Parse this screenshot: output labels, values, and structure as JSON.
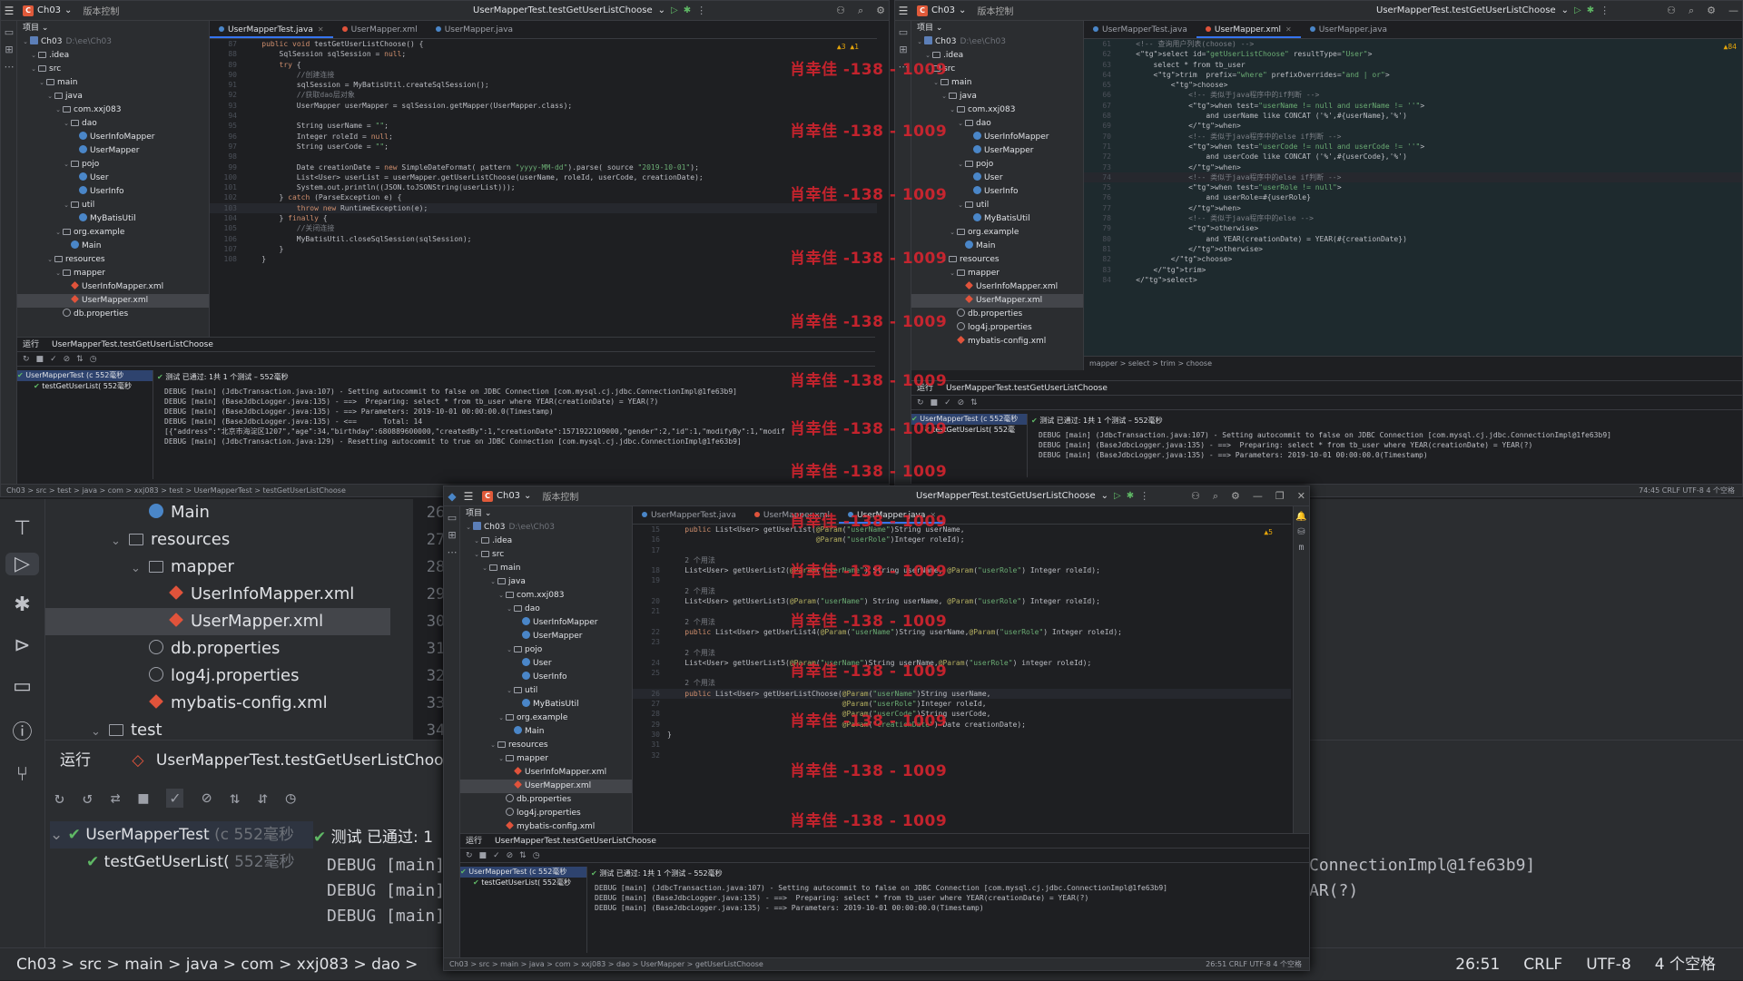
{
  "win1": {
    "project": "Ch03",
    "vcs": "版本控制",
    "run_config": "UserMapperTest.testGetUserListChoose",
    "tabs": [
      {
        "label": "UserMapperTest.java",
        "active": true
      },
      {
        "label": "UserMapper.xml",
        "active": false
      },
      {
        "label": "UserMapper.java",
        "active": false
      }
    ],
    "tree_header": "项目",
    "tree": [
      {
        "t": "Ch03",
        "sub": "D:\\ee\\Ch03",
        "lvl": 0,
        "type": "mod"
      },
      {
        "t": ".idea",
        "lvl": 1,
        "type": "folder"
      },
      {
        "t": "src",
        "lvl": 1,
        "type": "folder"
      },
      {
        "t": "main",
        "lvl": 2,
        "type": "folder"
      },
      {
        "t": "java",
        "lvl": 3,
        "type": "folder"
      },
      {
        "t": "com.xxj083",
        "lvl": 4,
        "type": "pkg"
      },
      {
        "t": "dao",
        "lvl": 5,
        "type": "pkg"
      },
      {
        "t": "UserInfoMapper",
        "lvl": 6,
        "type": "cls"
      },
      {
        "t": "UserMapper",
        "lvl": 6,
        "type": "cls"
      },
      {
        "t": "pojo",
        "lvl": 5,
        "type": "pkg"
      },
      {
        "t": "User",
        "lvl": 6,
        "type": "cls"
      },
      {
        "t": "UserInfo",
        "lvl": 6,
        "type": "cls"
      },
      {
        "t": "util",
        "lvl": 5,
        "type": "pkg"
      },
      {
        "t": "MyBatisUtil",
        "lvl": 6,
        "type": "cls"
      },
      {
        "t": "org.example",
        "lvl": 4,
        "type": "pkg"
      },
      {
        "t": "Main",
        "lvl": 5,
        "type": "cls"
      },
      {
        "t": "resources",
        "lvl": 3,
        "type": "folder"
      },
      {
        "t": "mapper",
        "lvl": 4,
        "type": "folder"
      },
      {
        "t": "UserInfoMapper.xml",
        "lvl": 5,
        "type": "xml"
      },
      {
        "t": "UserMapper.xml",
        "lvl": 5,
        "type": "xml",
        "sel": true
      },
      {
        "t": "db.properties",
        "lvl": 4,
        "type": "prop"
      }
    ],
    "code": [
      {
        "n": "87",
        "t": "    public void testGetUserListChoose() {"
      },
      {
        "n": "88",
        "t": "        SqlSession sqlSession = null;"
      },
      {
        "n": "89",
        "t": "        try {"
      },
      {
        "n": "90",
        "t": "            //创建连接"
      },
      {
        "n": "91",
        "t": "            sqlSession = MyBatisUtil.createSqlSession();"
      },
      {
        "n": "92",
        "t": "            //获取dao层对象"
      },
      {
        "n": "93",
        "t": "            UserMapper userMapper = sqlSession.getMapper(UserMapper.class);"
      },
      {
        "n": "94",
        "t": ""
      },
      {
        "n": "95",
        "t": "            String userName = \"\";"
      },
      {
        "n": "96",
        "t": "            Integer roleId = null;"
      },
      {
        "n": "97",
        "t": "            String userCode = \"\";"
      },
      {
        "n": "98",
        "t": ""
      },
      {
        "n": "99",
        "t": "            Date creationDate = new SimpleDateFormat( pattern \"yyyy-MM-dd\").parse( source \"2019-10-01\");"
      },
      {
        "n": "100",
        "t": "            List<User> userList = userMapper.getUserListChoose(userName, roleId, userCode, creationDate);"
      },
      {
        "n": "101",
        "t": "            System.out.println((JSON.toJSONString(userList)));"
      },
      {
        "n": "102",
        "t": "        } catch (ParseException e) {"
      },
      {
        "n": "103",
        "t": "            throw new RuntimeException(e);",
        "hl": true
      },
      {
        "n": "104",
        "t": "        } finally {"
      },
      {
        "n": "105",
        "t": "            //关闭连接"
      },
      {
        "n": "106",
        "t": "            MyBatisUtil.closeSqlSession(sqlSession);"
      },
      {
        "n": "107",
        "t": "        }"
      },
      {
        "n": "108",
        "t": "    }"
      }
    ],
    "warn": "▲3 ▲1",
    "run_label": "运行",
    "run_tab": "UserMapperTest.testGetUserListChoose",
    "test_root": "UserMapperTest (c 552毫秒",
    "test_child": "testGetUserList( 552毫秒",
    "test_status": "测试 已通过: 1共 1 个测试 – 552毫秒",
    "console": [
      "DEBUG [main] (JdbcTransaction.java:107) - Setting autocommit to false on JDBC Connection [com.mysql.cj.jdbc.ConnectionImpl@1fe63b9]",
      "DEBUG [main] (BaseJdbcLogger.java:135) - ==>  Preparing: select * from tb_user where YEAR(creationDate) = YEAR(?)",
      "DEBUG [main] (BaseJdbcLogger.java:135) - ==> Parameters: 2019-10-01 00:00:00.0(Timestamp)",
      "DEBUG [main] (BaseJdbcLogger.java:135) - <==      Total: 14",
      "[{\"address\":\"北京市海淀区1207\",\"age\":34,\"birthday\":680889600000,\"createdBy\":1,\"creationDate\":1571922109000,\"gender\":2,\"id\":1,\"modifyBy\":1,\"modif",
      "DEBUG [main] (JdbcTransaction.java:129) - Resetting autocommit to true on JDBC Connection [com.mysql.cj.jdbc.ConnectionImpl@1fe63b9]"
    ],
    "crumbs": "Ch03 > src > test > java > com > xxj083 > test > UserMapperTest > testGetUserListChoose"
  },
  "win2": {
    "project": "Ch03",
    "vcs": "版本控制",
    "run_config": "UserMapperTest.testGetUserListChoose",
    "tabs": [
      {
        "label": "UserMapperTest.java",
        "active": false
      },
      {
        "label": "UserMapper.xml",
        "active": true
      },
      {
        "label": "UserMapper.java",
        "active": false
      }
    ],
    "tree_header": "项目",
    "tree": [
      {
        "t": "Ch03",
        "sub": "D:\\ee\\Ch03",
        "lvl": 0,
        "type": "mod"
      },
      {
        "t": ".idea",
        "lvl": 1,
        "type": "folder"
      },
      {
        "t": "src",
        "lvl": 1,
        "type": "folder"
      },
      {
        "t": "main",
        "lvl": 2,
        "type": "folder"
      },
      {
        "t": "java",
        "lvl": 3,
        "type": "folder"
      },
      {
        "t": "com.xxj083",
        "lvl": 4,
        "type": "pkg"
      },
      {
        "t": "dao",
        "lvl": 5,
        "type": "pkg"
      },
      {
        "t": "UserInfoMapper",
        "lvl": 6,
        "type": "cls"
      },
      {
        "t": "UserMapper",
        "lvl": 6,
        "type": "cls"
      },
      {
        "t": "pojo",
        "lvl": 5,
        "type": "pkg"
      },
      {
        "t": "User",
        "lvl": 6,
        "type": "cls"
      },
      {
        "t": "UserInfo",
        "lvl": 6,
        "type": "cls"
      },
      {
        "t": "util",
        "lvl": 5,
        "type": "pkg"
      },
      {
        "t": "MyBatisUtil",
        "lvl": 6,
        "type": "cls"
      },
      {
        "t": "org.example",
        "lvl": 4,
        "type": "pkg"
      },
      {
        "t": "Main",
        "lvl": 5,
        "type": "cls"
      },
      {
        "t": "resources",
        "lvl": 3,
        "type": "folder"
      },
      {
        "t": "mapper",
        "lvl": 4,
        "type": "folder"
      },
      {
        "t": "UserInfoMapper.xml",
        "lvl": 5,
        "type": "xml"
      },
      {
        "t": "UserMapper.xml",
        "lvl": 5,
        "type": "xml",
        "sel": true
      },
      {
        "t": "db.properties",
        "lvl": 4,
        "type": "prop"
      },
      {
        "t": "log4j.properties",
        "lvl": 4,
        "type": "prop"
      },
      {
        "t": "mybatis-config.xml",
        "lvl": 4,
        "type": "xml"
      }
    ],
    "code": [
      {
        "n": "61",
        "t": "    <!-- 查询用户列表(choose) -->"
      },
      {
        "n": "62",
        "t": "    <select id=\"getUserListChoose\" resultType=\"User\">"
      },
      {
        "n": "63",
        "t": "        select * from tb_user"
      },
      {
        "n": "64",
        "t": "        <trim  prefix=\"where\" prefixOverrides=\"and | or\">"
      },
      {
        "n": "65",
        "t": "            <choose>"
      },
      {
        "n": "66",
        "t": "                <!-- 类似于java程序中的if判断 -->"
      },
      {
        "n": "67",
        "t": "                <when test=\"userName != null and userName != ''\">"
      },
      {
        "n": "68",
        "t": "                    and userName like CONCAT ('%',#{userName},'%')"
      },
      {
        "n": "69",
        "t": "                </when>"
      },
      {
        "n": "70",
        "t": "                <!-- 类似于java程序中的else if判断 -->"
      },
      {
        "n": "71",
        "t": "                <when test=\"userCode != null and userCode != ''\">"
      },
      {
        "n": "72",
        "t": "                    and userCode like CONCAT ('%',#{userCode},'%')"
      },
      {
        "n": "73",
        "t": "                </when>"
      },
      {
        "n": "74",
        "t": "                <!-- 类似于java程序中的else if判断 -->",
        "hl": true
      },
      {
        "n": "75",
        "t": "                <when test=\"userRole != null\">"
      },
      {
        "n": "76",
        "t": "                    and userRole=#{userRole}"
      },
      {
        "n": "77",
        "t": "                </when>"
      },
      {
        "n": "78",
        "t": "                <!-- 类似于java程序中的else -->"
      },
      {
        "n": "79",
        "t": "                <otherwise>"
      },
      {
        "n": "80",
        "t": "                    and YEAR(creationDate) = YEAR(#{creationDate})"
      },
      {
        "n": "81",
        "t": "                </otherwise>"
      },
      {
        "n": "82",
        "t": "            </choose>"
      },
      {
        "n": "83",
        "t": "        </trim>"
      },
      {
        "n": "84",
        "t": "    </select>"
      }
    ],
    "warn": "▲84",
    "crumbs": "mapper > select > trim > choose",
    "run_label": "运行",
    "run_tab": "UserMapperTest.testGetUserListChoose",
    "test_root": "UserMapperTest (c 552毫秒",
    "test_child": "testGetUserList( 552毫",
    "test_status": "测试 已通过: 1共 1 个测试 – 552毫秒",
    "console": [
      "DEBUG [main] (JdbcTransaction.java:107) - Setting autocommit to false on JDBC Connection [com.mysql.cj.jdbc.ConnectionImpl@1fe63b9]",
      "DEBUG [main] (BaseJdbcLogger.java:135) - ==>  Preparing: select * from tb_user where YEAR(creationDate) = YEAR(?)",
      "DEBUG [main] (BaseJdbcLogger.java:135) - ==> Parameters: 2019-10-01 00:00:00.0(Timestamp)"
    ],
    "status_right": "74:45   CRLF   UTF-8   4 个空格"
  },
  "win3": {
    "project": "Ch03",
    "vcs": "版本控制",
    "run_config": "UserMapperTest.testGetUserListChoose",
    "tabs": [
      {
        "label": "UserMapperTest.java",
        "active": false
      },
      {
        "label": "UserMapper.xml",
        "active": false
      },
      {
        "label": "UserMapper.java",
        "active": true
      }
    ],
    "tree_header": "项目",
    "tree": [
      {
        "t": "Ch03",
        "sub": "D:\\ee\\Ch03",
        "lvl": 0,
        "type": "mod"
      },
      {
        "t": ".idea",
        "lvl": 1,
        "type": "folder"
      },
      {
        "t": "src",
        "lvl": 1,
        "type": "folder"
      },
      {
        "t": "main",
        "lvl": 2,
        "type": "folder"
      },
      {
        "t": "java",
        "lvl": 3,
        "type": "folder"
      },
      {
        "t": "com.xxj083",
        "lvl": 4,
        "type": "pkg"
      },
      {
        "t": "dao",
        "lvl": 5,
        "type": "pkg"
      },
      {
        "t": "UserInfoMapper",
        "lvl": 6,
        "type": "cls"
      },
      {
        "t": "UserMapper",
        "lvl": 6,
        "type": "cls"
      },
      {
        "t": "pojo",
        "lvl": 5,
        "type": "pkg"
      },
      {
        "t": "User",
        "lvl": 6,
        "type": "cls"
      },
      {
        "t": "UserInfo",
        "lvl": 6,
        "type": "cls"
      },
      {
        "t": "util",
        "lvl": 5,
        "type": "pkg"
      },
      {
        "t": "MyBatisUtil",
        "lvl": 6,
        "type": "cls"
      },
      {
        "t": "org.example",
        "lvl": 4,
        "type": "pkg"
      },
      {
        "t": "Main",
        "lvl": 5,
        "type": "cls"
      },
      {
        "t": "resources",
        "lvl": 3,
        "type": "folder"
      },
      {
        "t": "mapper",
        "lvl": 4,
        "type": "folder"
      },
      {
        "t": "UserInfoMapper.xml",
        "lvl": 5,
        "type": "xml"
      },
      {
        "t": "UserMapper.xml",
        "lvl": 5,
        "type": "xml",
        "sel": true
      },
      {
        "t": "db.properties",
        "lvl": 4,
        "type": "prop"
      },
      {
        "t": "log4j.properties",
        "lvl": 4,
        "type": "prop"
      },
      {
        "t": "mybatis-config.xml",
        "lvl": 4,
        "type": "xml"
      }
    ],
    "code": [
      {
        "n": "15",
        "t": "    public List<User> getUserList(@Param(\"userName\")String userName,"
      },
      {
        "n": "16",
        "t": "                                  @Param(\"userRole\")Integer roleId);"
      },
      {
        "n": "17",
        "t": ""
      },
      {
        "n": "",
        "t": "    2 个用法"
      },
      {
        "n": "18",
        "t": "    List<User> getUserList2(@Param(\"userName\") String userName, @Param(\"userRole\") Integer roleId);"
      },
      {
        "n": "19",
        "t": ""
      },
      {
        "n": "",
        "t": "    2 个用法"
      },
      {
        "n": "20",
        "t": "    List<User> getUserList3(@Param(\"userName\") String userName, @Param(\"userRole\") Integer roleId);"
      },
      {
        "n": "21",
        "t": ""
      },
      {
        "n": "",
        "t": "    2 个用法"
      },
      {
        "n": "22",
        "t": "    public List<User> getUserList4(@Param(\"userName\")String userName,@Param(\"userRole\") Integer roleId);"
      },
      {
        "n": "23",
        "t": ""
      },
      {
        "n": "",
        "t": "    2 个用法"
      },
      {
        "n": "24",
        "t": "    List<User> getUserList5(@Param(\"userName\")String userName,@Param(\"userRole\") integer roleId);"
      },
      {
        "n": "25",
        "t": ""
      },
      {
        "n": "",
        "t": "    2 个用法"
      },
      {
        "n": "26",
        "t": "    public List<User> getUserListChoose(@Param(\"userName\")String userName,",
        "hl": true
      },
      {
        "n": "27",
        "t": "                                        @Param(\"userRole\")Integer roleId,"
      },
      {
        "n": "28",
        "t": "                                        @Param(\"userCode\")String userCode,"
      },
      {
        "n": "29",
        "t": "                                        @Param(\"creationDate\") Date creationDate);"
      },
      {
        "n": "30",
        "t": "}"
      },
      {
        "n": "31",
        "t": ""
      },
      {
        "n": "32",
        "t": ""
      }
    ],
    "warn": "▲5",
    "run_label": "运行",
    "run_tab": "UserMapperTest.testGetUserListChoose",
    "test_root": "UserMapperTest (c 552毫秒",
    "test_child": "testGetUserList( 552毫秒",
    "test_status": "测试 已通过: 1共 1 个测试 – 552毫秒",
    "console": [
      "DEBUG [main] (JdbcTransaction.java:107) - Setting autocommit to false on JDBC Connection [com.mysql.cj.jdbc.ConnectionImpl@1fe63b9]",
      "DEBUG [main] (BaseJdbcLogger.java:135) - ==>  Preparing: select * from tb_user where YEAR(creationDate) = YEAR(?)",
      "DEBUG [main] (BaseJdbcLogger.java:135) - ==> Parameters: 2019-10-01 00:00:00.0(Timestamp)"
    ],
    "crumbs": "Ch03 > src > main > java > com > xxj083 > dao > UserMapper > getUserListChoose",
    "status_right": "26:51   CRLF   UTF-8   4 个空格"
  },
  "big": {
    "tree": [
      {
        "t": "Main",
        "lvl": 2,
        "type": "cls"
      },
      {
        "t": "resources",
        "lvl": 1,
        "type": "folder"
      },
      {
        "t": "mapper",
        "lvl": 2,
        "type": "folder"
      },
      {
        "t": "UserInfoMapper.xml",
        "lvl": 3,
        "type": "xml"
      },
      {
        "t": "UserMapper.xml",
        "lvl": 3,
        "type": "xml",
        "sel": true
      },
      {
        "t": "db.properties",
        "lvl": 2,
        "type": "prop"
      },
      {
        "t": "log4j.properties",
        "lvl": 2,
        "type": "prop"
      },
      {
        "t": "mybatis-config.xml",
        "lvl": 2,
        "type": "xml"
      },
      {
        "t": "test",
        "lvl": 0,
        "type": "folder"
      }
    ],
    "gutter": [
      "26",
      "27",
      "28",
      "29",
      "30",
      "31",
      "32",
      "33",
      "34"
    ],
    "run_label": "运行",
    "run_tab": "UserMapperTest.testGetUserListChoose",
    "test_root": "UserMapperTest",
    "test_root_time": "(c 552毫秒",
    "test_child": "testGetUserList(",
    "test_child_time": "552毫秒",
    "test_status": "测试 已通过: 1",
    "console": [
      "DEBUG [main]",
      "DEBUG [main]",
      "DEBUG [main]"
    ],
    "console_right": [
      "ConnectionImpl@1fe63b9]",
      "AR(?)"
    ],
    "status_crumbs": "Ch03 > src > main > java > com > xxj083 > dao >",
    "status_right": [
      "26:51",
      "CRLF",
      "UTF-8",
      "4 个空格"
    ]
  },
  "watermark": "肖幸佳 -138 - 1009"
}
